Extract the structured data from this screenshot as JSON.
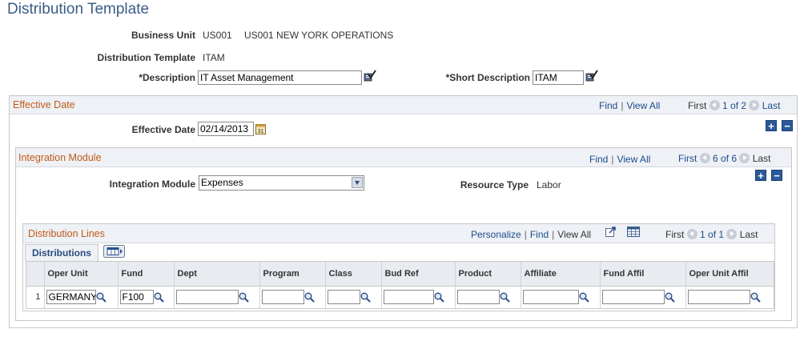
{
  "page": {
    "title": "Distribution Template"
  },
  "header": {
    "business_unit_label": "Business Unit",
    "business_unit_code": "US001",
    "business_unit_name": "US001 NEW YORK OPERATIONS",
    "distribution_template_label": "Distribution Template",
    "distribution_template_value": "ITAM",
    "description_label": "*Description",
    "description_value": "IT Asset Management",
    "short_description_label": "*Short Description",
    "short_description_value": "ITAM"
  },
  "effective_date_section": {
    "title": "Effective Date",
    "find": "Find",
    "view_all": "View All",
    "first": "First",
    "paging": "1 of 2",
    "last": "Last",
    "effective_date_label": "Effective Date",
    "effective_date_value": "02/14/2013"
  },
  "integration_module_section": {
    "title": "Integration Module",
    "find": "Find",
    "view_all": "View All",
    "first": "First",
    "paging": "6 of 6",
    "last": "Last",
    "integration_module_label": "Integration Module",
    "integration_module_value": "Expenses",
    "resource_type_label": "Resource Type",
    "resource_type_value": "Labor"
  },
  "distribution_lines": {
    "title": "Distribution Lines",
    "personalize": "Personalize",
    "find": "Find",
    "view_all": "View All",
    "first": "First",
    "paging": "1 of 1",
    "last": "Last",
    "tab_label": "Distributions",
    "columns": [
      "Oper Unit",
      "Fund",
      "Dept",
      "Program",
      "Class",
      "Bud Ref",
      "Product",
      "Affiliate",
      "Fund Affil",
      "Oper Unit Affil"
    ],
    "rows": [
      {
        "num": "1",
        "oper_unit": "GERMANY",
        "fund": "F100",
        "dept": "",
        "program": "",
        "class": "",
        "bud_ref": "",
        "product": "",
        "affiliate": "",
        "fund_affil": "",
        "oper_unit_affil": ""
      }
    ]
  },
  "colors": {
    "title": "#3b5b87",
    "section_header": "#c05a1a",
    "link": "#1d4a8d",
    "header_bg": "#eef1f5"
  }
}
